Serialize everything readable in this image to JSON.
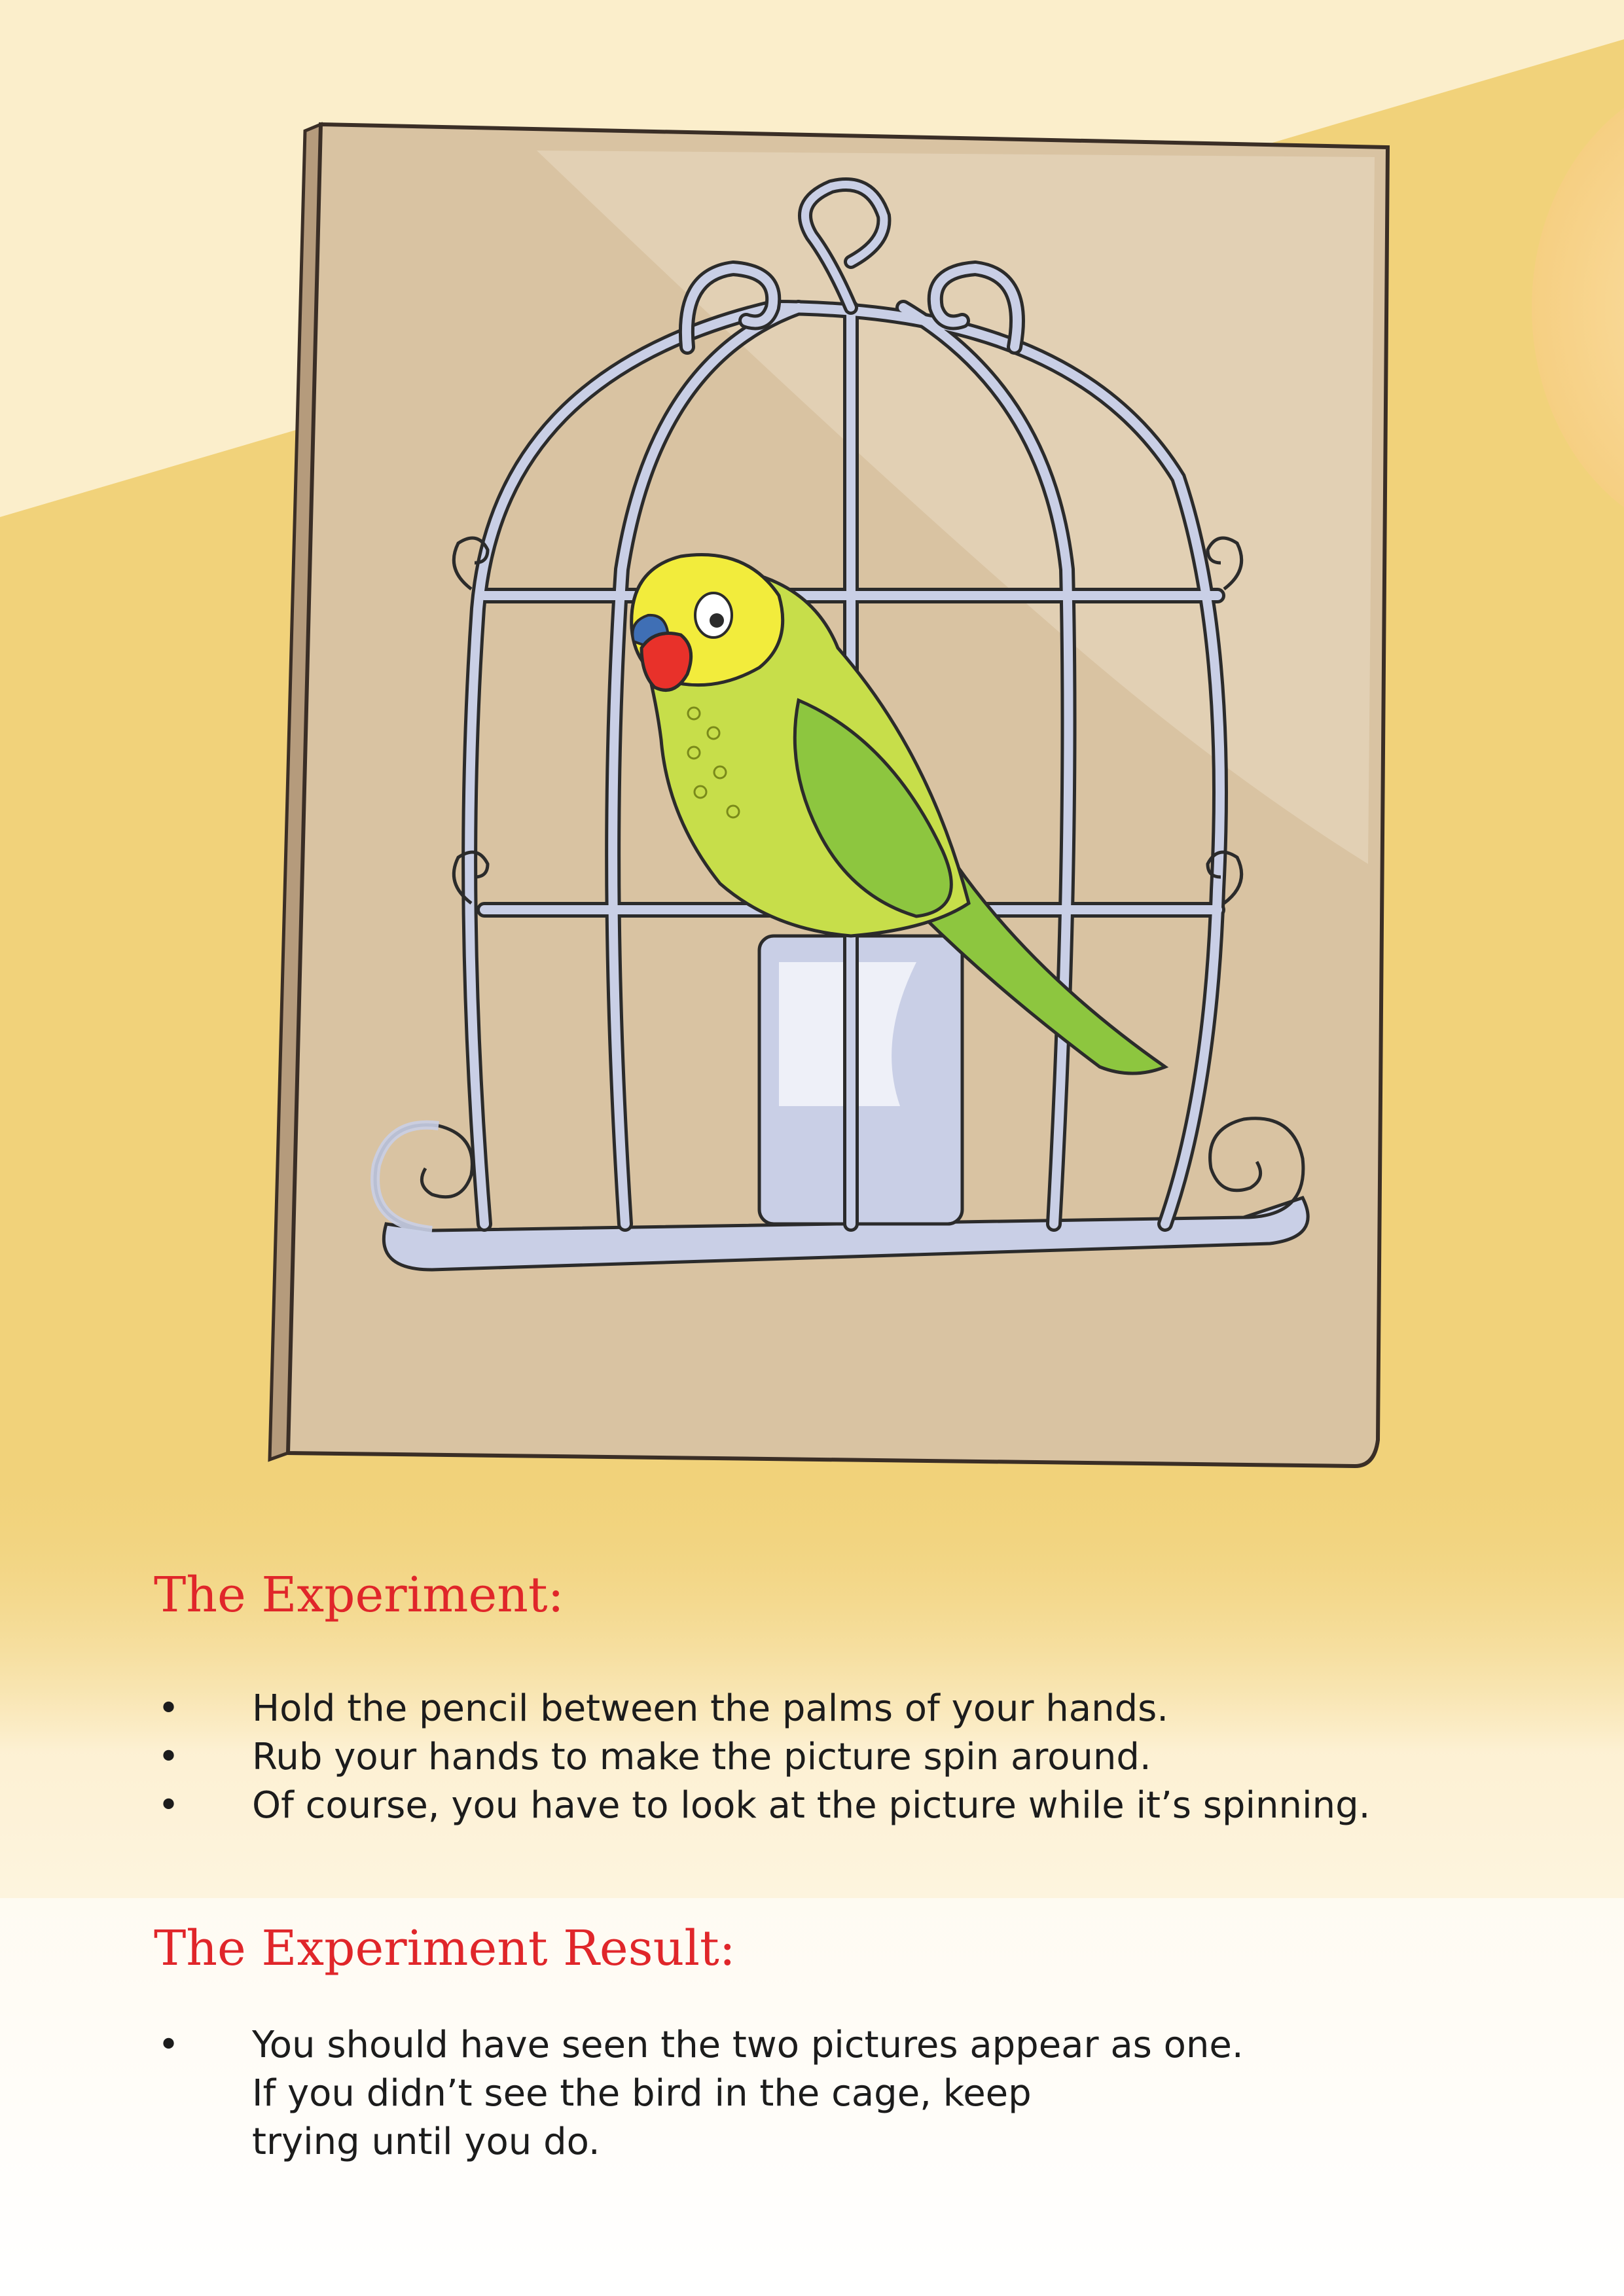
{
  "experiment": {
    "heading": "The Experiment:",
    "steps": [
      "Hold the pencil between the palms of your hands.",
      "Rub your hands to make the picture spin around.",
      "Of course, you have to look at the picture while it’s spinning."
    ]
  },
  "result": {
    "heading": "The Experiment Result:",
    "lines": [
      "You should have seen the two pictures appear as one.",
      "If you didn’t see the bird in the cage, keep",
      "trying until you do."
    ]
  },
  "colors": {
    "heading": "#e0262a",
    "body_text": "#1c1c1c",
    "background_top": "#fbeecb",
    "background_band": "#f1d27a",
    "board": "#d9c3a2",
    "cage": "#c9cfe6",
    "parrot_head": "#f2ec3c",
    "parrot_body": "#8dc63f",
    "parrot_beak": "#e8312a"
  }
}
